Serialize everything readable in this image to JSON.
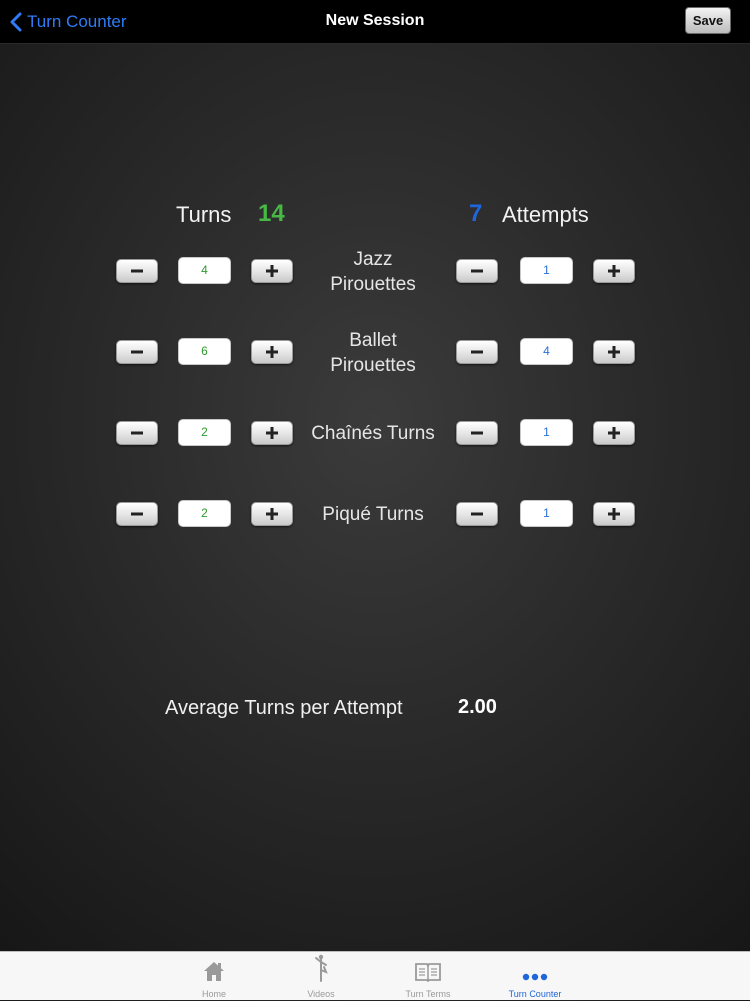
{
  "navbar": {
    "back_label": "Turn Counter",
    "title": "New Session",
    "save_label": "Save"
  },
  "summary": {
    "turns_label": "Turns",
    "turns_total": "14",
    "attempts_total": "7",
    "attempts_label": "Attempts"
  },
  "rows": [
    {
      "label_line1": "Jazz",
      "label_line2": "Pirouettes",
      "turns": "4",
      "attempts": "1"
    },
    {
      "label_line1": "Ballet",
      "label_line2": "Pirouettes",
      "turns": "6",
      "attempts": "4"
    },
    {
      "label_line1": "Chaînés Turns",
      "label_line2": "",
      "turns": "2",
      "attempts": "1"
    },
    {
      "label_line1": "Piqué Turns",
      "label_line2": "",
      "turns": "2",
      "attempts": "1"
    }
  ],
  "average": {
    "label": "Average Turns per Attempt",
    "value": "2.00"
  },
  "tabbar": {
    "items": [
      {
        "label": "Home",
        "icon": "home-icon"
      },
      {
        "label": "Videos",
        "icon": "dancer-icon"
      },
      {
        "label": "Turn Terms",
        "icon": "book-icon"
      },
      {
        "label": "Turn Counter",
        "icon": "more-dots-icon"
      }
    ],
    "active_index": 3
  },
  "colors": {
    "turns_green": "#47b845",
    "attempts_blue": "#1f66d9",
    "ios_blue": "#2f7cf6"
  }
}
